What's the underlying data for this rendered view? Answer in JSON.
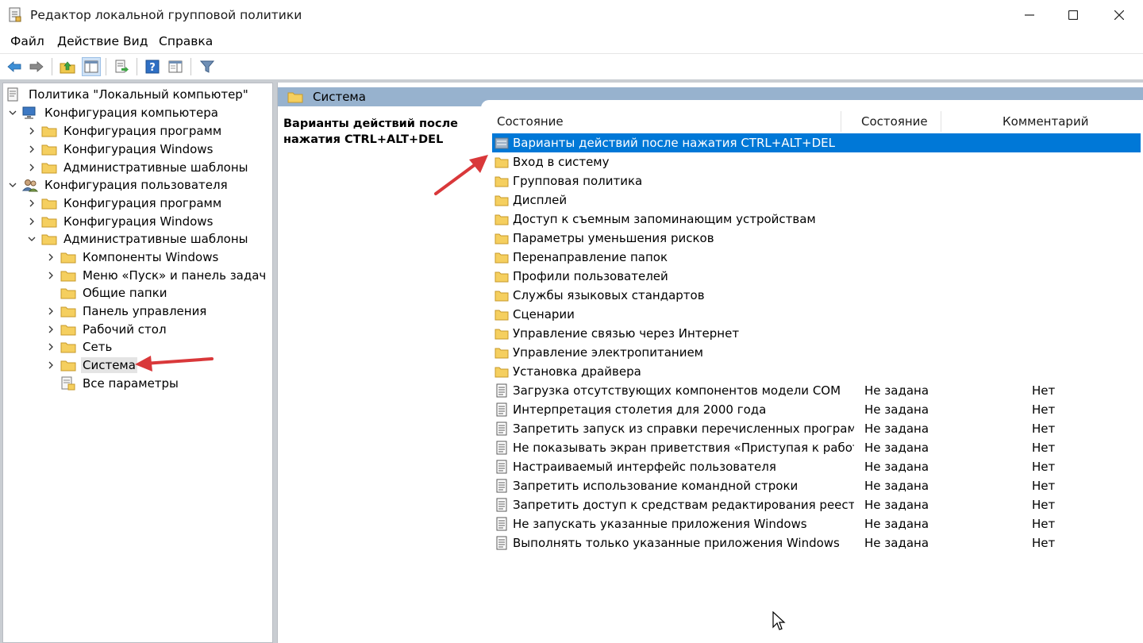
{
  "window": {
    "title": "Редактор локальной групповой политики"
  },
  "menu": {
    "items": [
      "Файл",
      "Действие",
      "Вид",
      "Справка"
    ]
  },
  "toolbar": {
    "buttons": [
      "back-icon",
      "forward-icon",
      "up-folder-icon",
      "show-hide-tree-icon",
      "export-list-icon",
      "help-icon",
      "properties-view-icon",
      "filter-icon"
    ]
  },
  "tree": {
    "root": "Политика \"Локальный компьютер\"",
    "computer_config": "Конфигурация компьютера",
    "cc_programs": "Конфигурация программ",
    "cc_windows": "Конфигурация Windows",
    "cc_admin": "Административные шаблоны",
    "user_config": "Конфигурация пользователя",
    "uc_programs": "Конфигурация программ",
    "uc_windows": "Конфигурация Windows",
    "uc_admin": "Административные шаблоны",
    "windows_components": "Компоненты Windows",
    "start_menu": "Меню «Пуск» и панель задач",
    "shared_folders": "Общие папки",
    "control_panel": "Панель управления",
    "desktop": "Рабочий стол",
    "network": "Сеть",
    "system": "Система",
    "all_settings": "Все параметры"
  },
  "right_pane": {
    "header": "Система",
    "description": "Варианты действий после нажатия CTRL+ALT+DEL",
    "columns": {
      "name": "Состояние",
      "state": "Состояние",
      "comment": "Комментарий"
    },
    "folders": [
      "Варианты действий после нажатия CTRL+ALT+DEL",
      "Вход в систему",
      "Групповая политика",
      "Дисплей",
      "Доступ к съемным запоминающим устройствам",
      "Параметры уменьшения рисков",
      "Перенаправление папок",
      "Профили пользователей",
      "Службы языковых стандартов",
      "Сценарии",
      "Управление связью через Интернет",
      "Управление электропитанием",
      "Установка драйвера"
    ],
    "policies": [
      {
        "name": "Загрузка отсутствующих компонентов модели COM",
        "state": "Не задана",
        "comment": "Нет"
      },
      {
        "name": "Интерпретация столетия для 2000 года",
        "state": "Не задана",
        "comment": "Нет"
      },
      {
        "name": "Запретить запуск из справки перечисленных программ",
        "state": "Не задана",
        "comment": "Нет"
      },
      {
        "name": "Не показывать экран приветствия «Приступая к работе» ...",
        "state": "Не задана",
        "comment": "Нет"
      },
      {
        "name": "Настраиваемый интерфейс пользователя",
        "state": "Не задана",
        "comment": "Нет"
      },
      {
        "name": "Запретить использование командной строки",
        "state": "Не задана",
        "comment": "Нет"
      },
      {
        "name": "Запретить доступ к средствам редактирования реестра",
        "state": "Не задана",
        "comment": "Нет"
      },
      {
        "name": "Не запускать указанные приложения Windows",
        "state": "Не задана",
        "comment": "Нет"
      },
      {
        "name": "Выполнять только указанные приложения Windows",
        "state": "Не задана",
        "comment": "Нет"
      }
    ]
  },
  "colors": {
    "selection": "#0078d7",
    "header_band": "#97b2ce",
    "annotation_arrow": "#d9383a"
  }
}
